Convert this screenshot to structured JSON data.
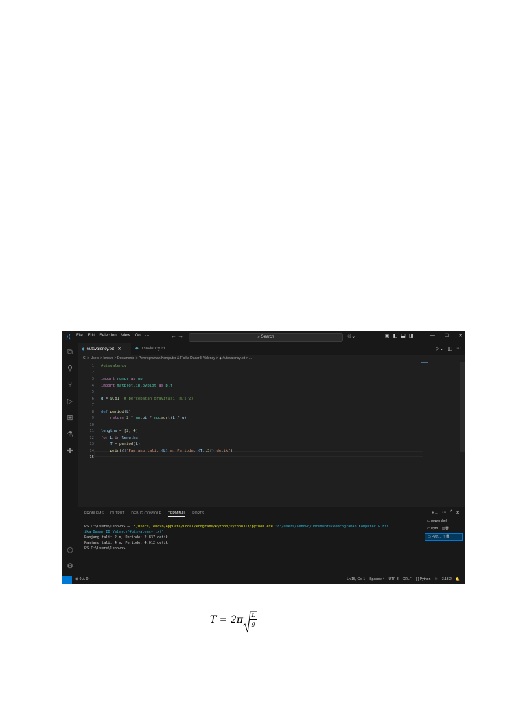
{
  "titlebar": {
    "menu": [
      "File",
      "Edit",
      "Selection",
      "View",
      "Go",
      "···"
    ],
    "nav_arrows": "←  →",
    "search_placeholder": "Search",
    "window_buttons": [
      "—",
      "☐",
      "✕"
    ]
  },
  "tabs": [
    {
      "label": "#utsvalency.txt",
      "close": "✕"
    },
    {
      "label": "utsvalency.txt"
    }
  ],
  "breadcrumb": "C: > Users > lenovo > Documents > Pemrograman Komputer & Fisika Dasar II Valency > ◆ #utsvalency.txt > ...",
  "editor": {
    "line_numbers": [
      "1",
      "2",
      "3",
      "4",
      "5",
      "6",
      "7",
      "8",
      "9",
      "10",
      "11",
      "12",
      "13",
      "14",
      "15"
    ],
    "lines": [
      "#utsvalency",
      "",
      "import numpy as np",
      "import matplotlib.pyplot as plt",
      "",
      "g = 9.81  # percepatan gravitasi (m/s^2)",
      "",
      "def period(L):",
      "    return 2 * np.pi * np.sqrt(L / g)",
      "",
      "lengths = [2, 4]",
      "for L in lengths:",
      "    T = period(L)",
      "    print(f\"Panjang tali: {L} m, Periode: {T:.3f} detik\")",
      ""
    ]
  },
  "panel": {
    "tabs": [
      "PROBLEMS",
      "OUTPUT",
      "DEBUG CONSOLE",
      "TERMINAL",
      "PORTS"
    ],
    "active_tab": "TERMINAL",
    "terminal": {
      "cmd_prompt": "PS C:\\Users\\lenovo> & ",
      "cmd_exe": "C:/Users/lenovo/AppData/Local/Programs/Python/Python313/python.exe",
      "cmd_arg": " \"c:/Users/lenovo/Documents/Pemrograman Komputer & Fis",
      "cmd_arg_cont": "ika Dasar II Valency/#utsvalency.txt\"",
      "out1": "Panjang tali: 2 m, Periode: 2.837 detik",
      "out2": "Panjang tali: 4 m, Periode: 4.012 detik",
      "prompt_end": "PS C:\\Users\\lenovo>"
    },
    "terminal_list": [
      "powershell",
      "Pyth...",
      "Pyth..."
    ]
  },
  "statusbar": {
    "errors": "⊗ 0 ⚠ 0",
    "position": "Ln 15, Col 1",
    "spaces": "Spaces: 4",
    "encoding": "UTF-8",
    "eol": "CRLF",
    "language": "{ } Python",
    "python_version": "3.13.2"
  },
  "formula": {
    "lhs": "T = 2π",
    "numerator": "L",
    "denominator": "g"
  }
}
